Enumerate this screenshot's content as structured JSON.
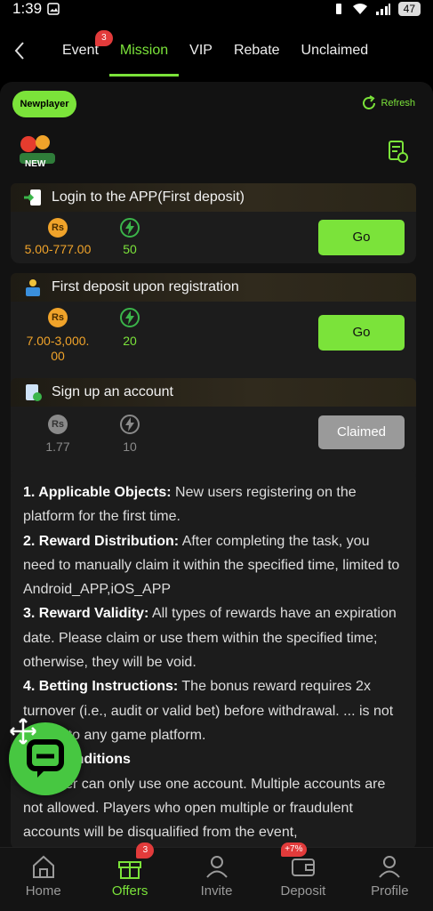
{
  "status_bar": {
    "time": "1:39",
    "battery": "47"
  },
  "nav": {
    "tabs": [
      {
        "label": "Event",
        "badge": "3"
      },
      {
        "label": "Mission",
        "active": true
      },
      {
        "label": "VIP"
      },
      {
        "label": "Rebate"
      },
      {
        "label": "Unclaimed"
      }
    ]
  },
  "filter": {
    "label": "Newplayer"
  },
  "refresh": {
    "label": "Refresh"
  },
  "new_badge": {
    "label": "NEW"
  },
  "tasks": [
    {
      "title": "Login to the APP(First deposit)",
      "coin_symbol": "Rs",
      "amount": "5.00-777.00",
      "points": "50",
      "button": "Go"
    },
    {
      "title": "First deposit upon registration",
      "coin_symbol": "Rs",
      "amount_line1": "7.00-3,000.",
      "amount_line2": "00",
      "points": "20",
      "button": "Go"
    },
    {
      "title": "Sign up an account",
      "coin_symbol": "Rs",
      "amount": "1.77",
      "points": "10",
      "button": "Claimed"
    }
  ],
  "rules": {
    "items": [
      {
        "heading": "1. Applicable Objects:",
        "text": " New users registering on the platform for the first time."
      },
      {
        "heading": "2. Reward Distribution:",
        "text": " After completing the task, you need to manually claim it within the specified time, limited to Android_APP,iOS_APP"
      },
      {
        "heading": "3. Reward Validity:",
        "text": " All types of rewards have an expiration date. Please claim or use them within the specified time; otherwise, they will be void."
      },
      {
        "heading": "4. Betting Instructions:",
        "text": " The bonus reward requires 2x turnover (i.e., audit or valid bet) before withdrawal. ... is not limited to any game platform."
      },
      {
        "heading": "...nd Conditions",
        "text": ""
      },
      {
        "heading": "",
        "text": "... player can only use one account. Multiple accounts are not allowed. Players who open multiple or fraudulent accounts will be disqualified from the event,"
      }
    ]
  },
  "bottom_nav": [
    {
      "label": "Home"
    },
    {
      "label": "Offers",
      "badge": "3",
      "active": true
    },
    {
      "label": "Invite"
    },
    {
      "label": "Deposit",
      "badge": "+7%"
    },
    {
      "label": "Profile"
    }
  ],
  "colors": {
    "accent": "#7be33a",
    "coin": "#f0a32a",
    "badge": "#e23b3b"
  }
}
